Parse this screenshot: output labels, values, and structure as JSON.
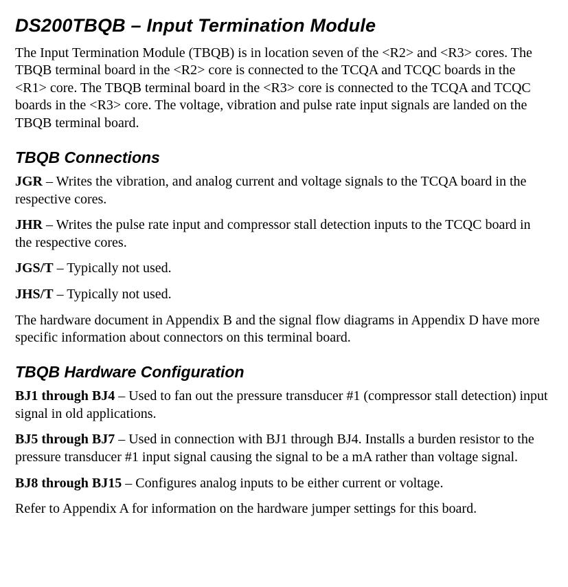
{
  "title": "DS200TBQB – Input Termination Module",
  "intro": "The Input Termination Module (TBQB) is in location seven of the <R2> and <R3> cores. The TBQB terminal board in the <R2> core is connected to the TCQA and TCQC boards in the <R1> core. The TBQB terminal board in the <R3> core is connected to the TCQA and TCQC boards in the <R3> core. The voltage, vibration and pulse rate input signals are landed on the TBQB terminal board.",
  "sections": {
    "connections": {
      "heading": "TBQB Connections",
      "items": [
        {
          "label": "JGR",
          "sep": " – ",
          "desc": "Writes the vibration, and analog current and voltage signals to the TCQA board in the respective cores."
        },
        {
          "label": "JHR",
          "sep": " – ",
          "desc": "Writes the pulse rate input and compressor stall detection inputs to the TCQC board in the respective cores."
        },
        {
          "label": "JGS/T",
          "sep": " – ",
          "desc": "Typically not used."
        },
        {
          "label": "JHS/T",
          "sep": " – ",
          "desc": "Typically not used."
        }
      ],
      "trailing": "The hardware document in Appendix B and the signal flow diagrams in Appendix D have more specific information about connectors on this terminal board."
    },
    "hardware": {
      "heading": "TBQB Hardware Configuration",
      "items": [
        {
          "label": "BJ1 through BJ4",
          "sep": " – ",
          "desc": "Used to fan out the pressure transducer #1 (compressor stall detection) input signal in old applications."
        },
        {
          "label": "BJ5 through BJ7",
          "sep": " – ",
          "desc": "Used in connection with BJ1 through BJ4. Installs a burden resistor to the pressure transducer #1 input signal causing the signal to be a mA rather than voltage signal."
        },
        {
          "label": "BJ8 through BJ15",
          "sep": " – ",
          "desc": "Configures analog inputs to be either current or voltage."
        }
      ],
      "trailing": "Refer to Appendix A for information on the hardware jumper settings for this board."
    }
  }
}
